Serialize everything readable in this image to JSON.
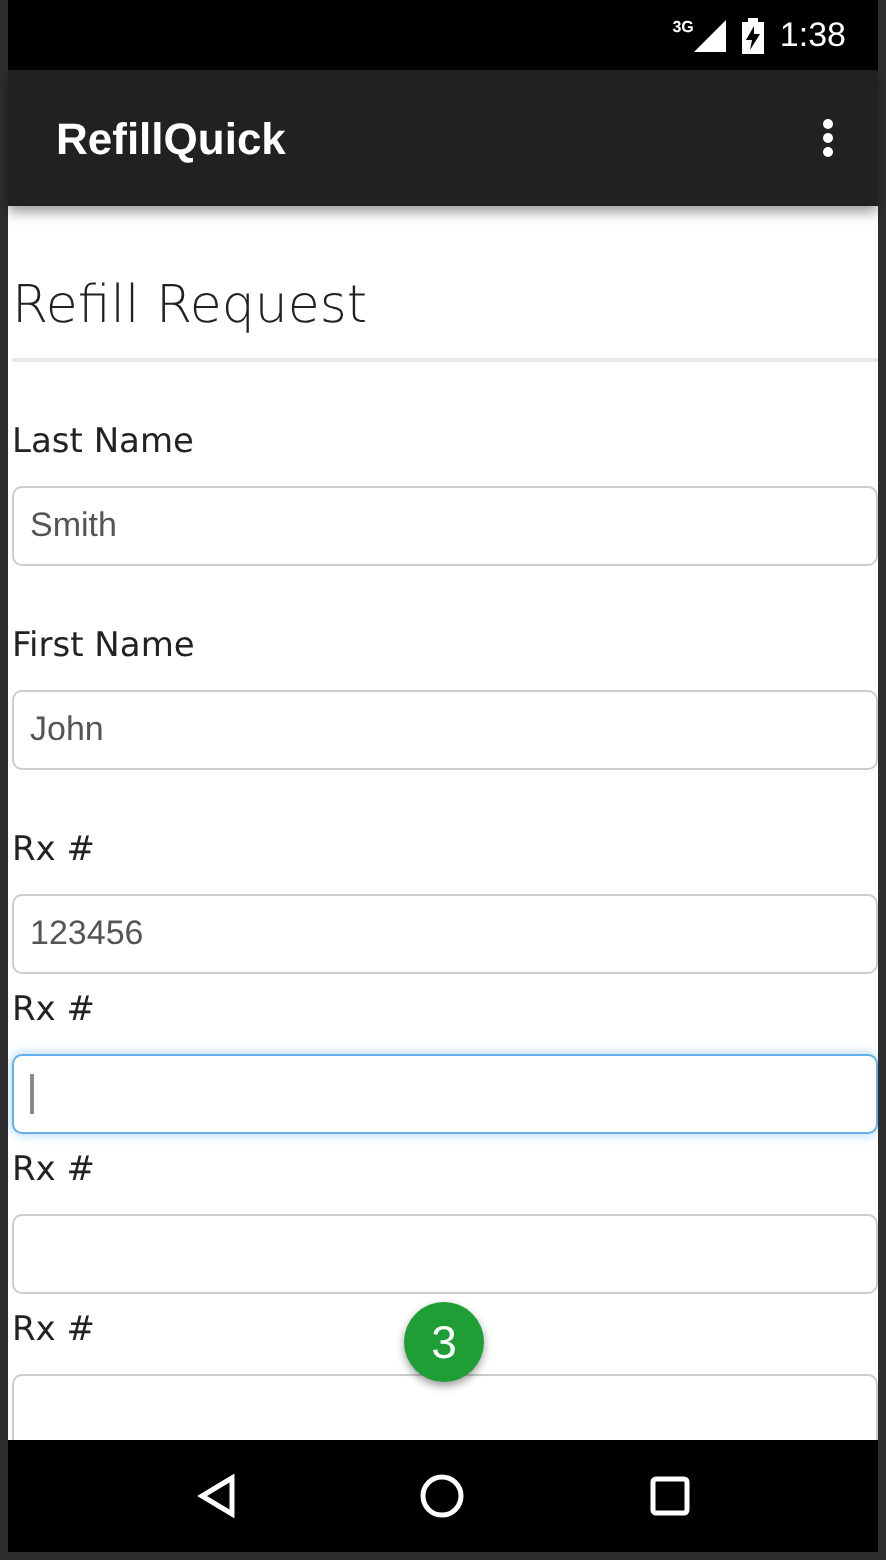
{
  "status_bar": {
    "network": "3G",
    "time": "1:38"
  },
  "app_bar": {
    "title": "RefillQuick"
  },
  "form": {
    "heading": "Refill Request",
    "groups": [
      [
        {
          "label": "Last Name",
          "value": "Smith",
          "focused": false
        }
      ],
      [
        {
          "label": "First Name",
          "value": "John",
          "focused": false
        }
      ],
      [
        {
          "label": "Rx #",
          "value": "123456",
          "focused": false
        },
        {
          "label": "Rx #",
          "focused": true
        },
        {
          "label": "Rx #",
          "focused": false
        },
        {
          "label": "Rx #",
          "focused": false
        }
      ]
    ]
  },
  "step_badge": "3"
}
